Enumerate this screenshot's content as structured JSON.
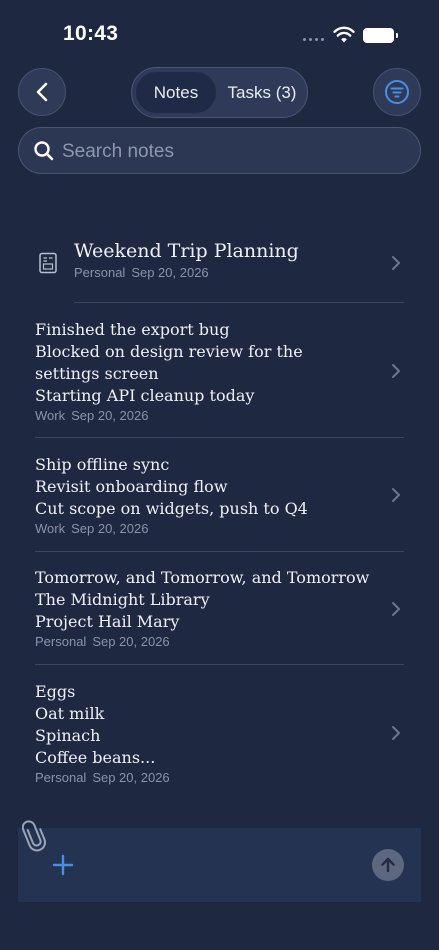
{
  "status_bar": {
    "time": "10:43"
  },
  "header": {
    "segments": [
      {
        "label": "Notes",
        "selected": true
      },
      {
        "label": "Tasks (3)",
        "selected": false
      }
    ]
  },
  "search": {
    "placeholder": "Search notes"
  },
  "notes": [
    {
      "lines": [
        "Weekend Trip Planning"
      ],
      "tag": "Personal",
      "date": "Sep 20, 2026",
      "has_icon": true
    },
    {
      "lines": [
        "Finished the export bug",
        "Blocked on design review for the",
        "settings screen",
        "Starting API cleanup today"
      ],
      "tag": "Work",
      "date": "Sep 20, 2026"
    },
    {
      "lines": [
        "Ship offline sync",
        "Revisit onboarding flow",
        "Cut scope on widgets, push to Q4"
      ],
      "tag": "Work",
      "date": "Sep 20, 2026"
    },
    {
      "lines": [
        "Tomorrow, and Tomorrow, and Tomorrow",
        "The Midnight Library",
        "Project Hail Mary"
      ],
      "tag": "Personal",
      "date": "Sep 20, 2026"
    },
    {
      "lines": [
        "Eggs",
        "Oat milk",
        "Spinach",
        "Coffee beans..."
      ],
      "tag": "Personal",
      "date": "Sep 20, 2026"
    }
  ],
  "icons": {
    "back": "chevron-left-icon",
    "filter": "filter-icon",
    "search": "search-icon",
    "note_type": "document-icon",
    "row_chevron": "chevron-right-icon",
    "attach": "paperclip-icon",
    "add": "plus-icon",
    "send": "arrow-up-icon"
  },
  "colors": {
    "background": "#1f2841",
    "accent": "#4a8fe7",
    "muted": "#8a93a8"
  }
}
